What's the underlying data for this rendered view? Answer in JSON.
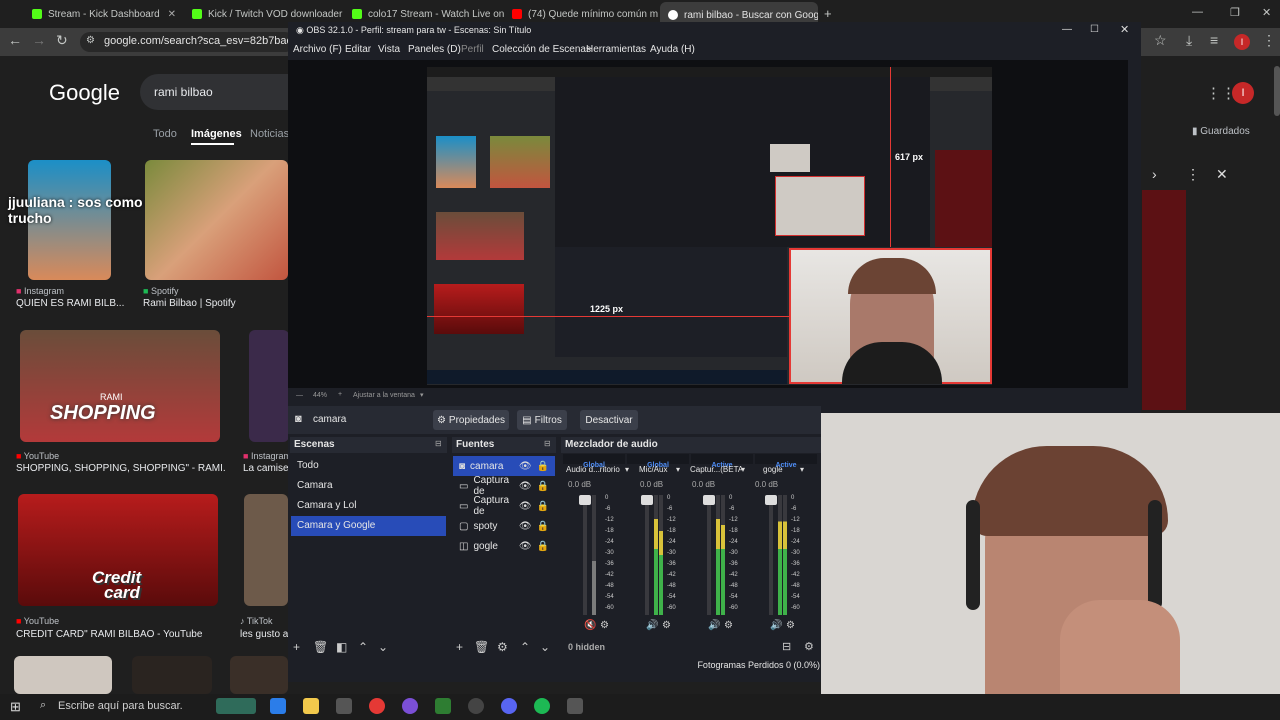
{
  "browser": {
    "tabs": [
      {
        "label": "Stream - Kick Dashboard",
        "color": "#53fc18"
      },
      {
        "label": "Kick / Twitch VOD downloader",
        "color": "#53fc18"
      },
      {
        "label": "colo17 Stream - Watch Live on",
        "color": "#53fc18"
      },
      {
        "label": "(74) Quede mínimo común m",
        "color": "#ff0000"
      },
      {
        "label": "rami bilbao - Buscar con Goog",
        "color": "#ffffff"
      }
    ],
    "url": "google.com/search?sca_esv=82b7bac21a73",
    "profile_initial": "I"
  },
  "google": {
    "logo": "Google",
    "query": "rami bilbao",
    "tabs": [
      "Todo",
      "Imágenes",
      "Noticias"
    ],
    "saved_label": "Guardados",
    "results": [
      {
        "source": "Instagram",
        "title": "QUIÉN ES RAMI BILB...",
        "overlay": "jjuuliana : sos como colorado trucho"
      },
      {
        "source": "Spotify",
        "title": "Rami Bilbao | Spotify"
      },
      {
        "source": "YouTube",
        "title": "SHOPPING, SHOPPING, SHOPPING\" - RAMI..."
      },
      {
        "source": "Instagram",
        "title": "La camise"
      },
      {
        "source": "YouTube",
        "title": "CREDIT CARD\" RAMI BILBAO - YouTube"
      },
      {
        "source": "TikTok",
        "title": "les gusto a"
      }
    ],
    "thumb_texts": [
      "RAMI",
      "SHOPPING",
      "Credit",
      "card"
    ]
  },
  "obs": {
    "title": "OBS 32.1.0 - Perfil: stream para tw - Escenas: Sin Título",
    "menu": [
      "Archivo (F)",
      "Editar",
      "Vista",
      "Paneles (D)",
      "Perfil",
      "Colección de Escenas",
      "Herramientas",
      "Ayuda (H)"
    ],
    "preview_labels": {
      "height": "617 px",
      "width": "1225 px"
    },
    "zoom": "44%",
    "zoom_label": "Ajustar a la ventana",
    "selected_source": "camara",
    "buttons": {
      "properties": "Propiedades",
      "filters": "Filtros",
      "deactivate": "Desactivar"
    },
    "scenes_title": "Escenas",
    "scenes": [
      "Todo",
      "Camara",
      "Camara y Lol",
      "Camara y Google"
    ],
    "sources_title": "Fuentes",
    "sources": [
      {
        "name": "camara",
        "icon": "camera-icon"
      },
      {
        "name": "Captura de",
        "icon": "window-capture-icon"
      },
      {
        "name": "Captura de",
        "icon": "window-capture-icon"
      },
      {
        "name": "spoty",
        "icon": "window-icon"
      },
      {
        "name": "gogle",
        "icon": "browser-icon"
      }
    ],
    "mixer_title": "Mezclador de audio",
    "mixer": [
      {
        "head": "Global",
        "name": "Audio d...ritorio",
        "db": "0.0 dB"
      },
      {
        "head": "Global",
        "name": "Mic/Aux",
        "db": "0.0 dB"
      },
      {
        "head": "Active",
        "name": "Captur...(BETA)",
        "db": "0.0 dB"
      },
      {
        "head": "Active",
        "name": "gogle",
        "db": "0.0 dB"
      }
    ],
    "scale": [
      "0",
      "-6",
      "-12",
      "-18",
      "-24",
      "-30",
      "-36",
      "-42",
      "-48",
      "-54",
      "-60"
    ],
    "hidden": "0 hidden",
    "status": "Fotogramas Perdidos 0 (0.0%)"
  },
  "taskbar": {
    "search_placeholder": "Escribe aquí para buscar."
  }
}
